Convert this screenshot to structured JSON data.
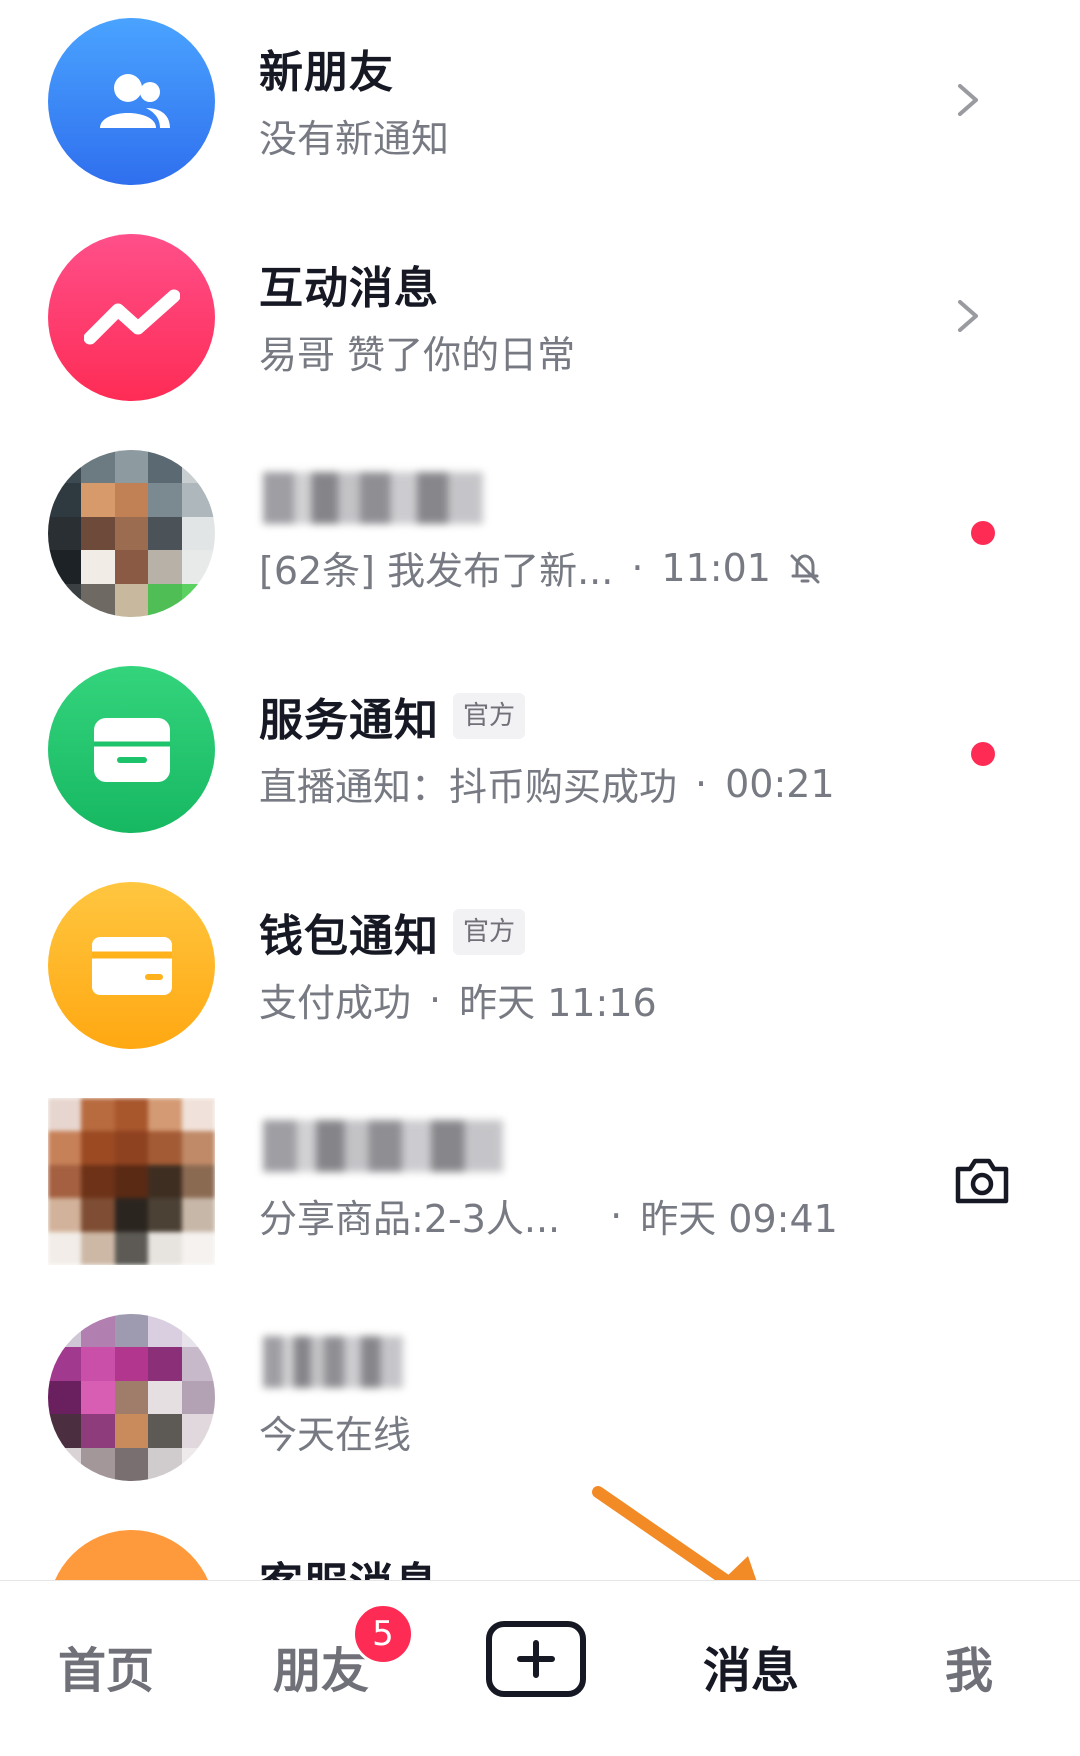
{
  "messages": [
    {
      "title": "新朋友",
      "subtitle": "没有新通知",
      "icon": "people-icon",
      "color": "#3a8ef5"
    },
    {
      "title": "互动消息",
      "subtitle": "易哥 赞了你的日常",
      "icon": "zigzag-icon",
      "color": "#fe2c6f"
    },
    {
      "subtitle": "[62条] 我发布了新...",
      "time": "11:01",
      "icon": "bell-muted-icon"
    },
    {
      "title": "服务通知",
      "tag": "官方",
      "subtitle": "直播通知：抖币购买成功",
      "time": "00:21",
      "icon": "inbox-icon",
      "color": "#1cc36a"
    },
    {
      "title": "钱包通知",
      "tag": "官方",
      "subtitle": "支付成功",
      "time": "昨天 11:16",
      "icon": "card-icon",
      "color": "#ffb21c"
    },
    {
      "subtitle": "分享商品:2-3人...",
      "time": "昨天 09:41",
      "icon": "camera-icon"
    },
    {
      "subtitle": "今天在线"
    },
    {
      "title": "客服消息",
      "color": "#ff9a3c"
    }
  ],
  "tabbar": {
    "home": "首页",
    "friends": "朋友",
    "friends_badge": "5",
    "messages": "消息",
    "me": "我",
    "active": "messages",
    "create_icon": "plus-icon"
  },
  "annotation": {
    "icon": "arrow-icon",
    "color": "#f28a25"
  }
}
